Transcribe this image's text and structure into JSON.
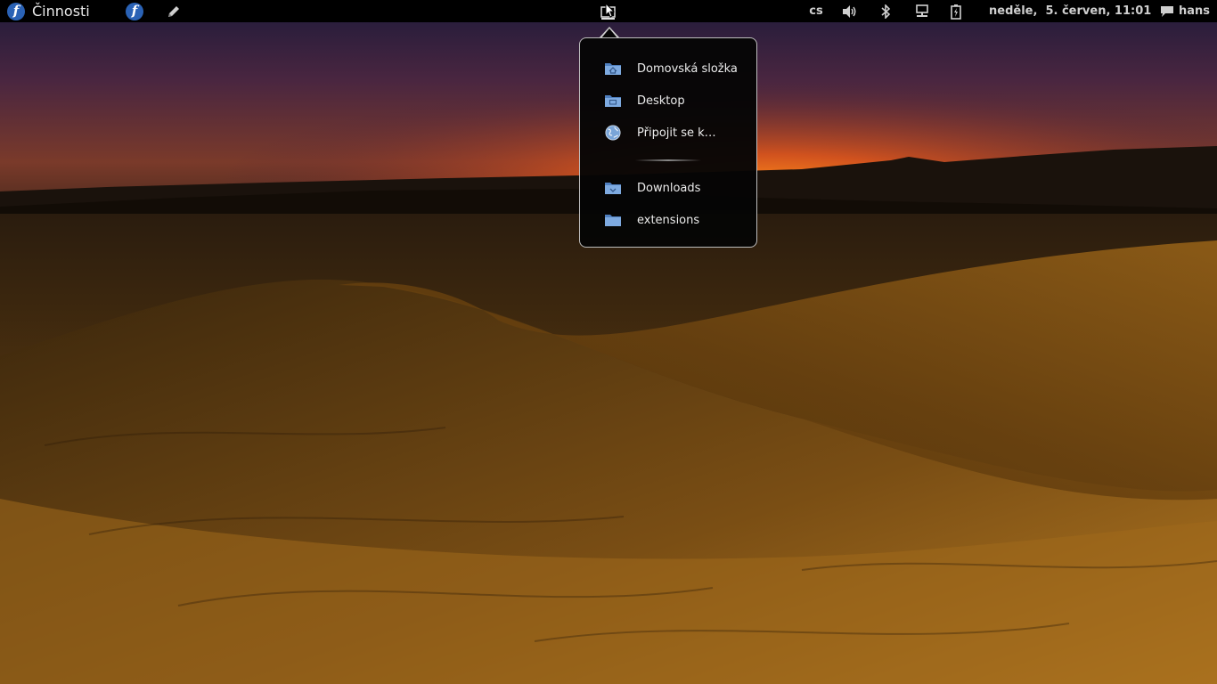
{
  "topbar": {
    "activities_label": "Činnosti",
    "keyboard_layout": "cs",
    "clock": "neděle,  5. červen, 11:01",
    "user_name": "hans"
  },
  "icons": {
    "activities": "fedora-logo-icon",
    "app_fedora": "fedora-logo-icon",
    "app_editor": "pencil-icon",
    "places": "places-folder-icon",
    "volume": "speaker-icon",
    "bluetooth": "bluetooth-icon",
    "network": "wired-network-icon",
    "battery": "battery-icon",
    "user": "chat-bubble-icon"
  },
  "places_menu": {
    "items": [
      {
        "label": "Domovská složka",
        "icon": "home-folder-icon"
      },
      {
        "label": "Desktop",
        "icon": "desktop-folder-icon"
      },
      {
        "label": "Připojit se k…",
        "icon": "globe-icon"
      }
    ],
    "bookmarks": [
      {
        "label": "Downloads",
        "icon": "downloads-folder-icon"
      },
      {
        "label": "extensions",
        "icon": "folder-icon"
      }
    ]
  },
  "colors": {
    "folder_blue": "#6f9fd8",
    "panel_bg": "#000000",
    "menu_border": "#bdbdbd"
  }
}
